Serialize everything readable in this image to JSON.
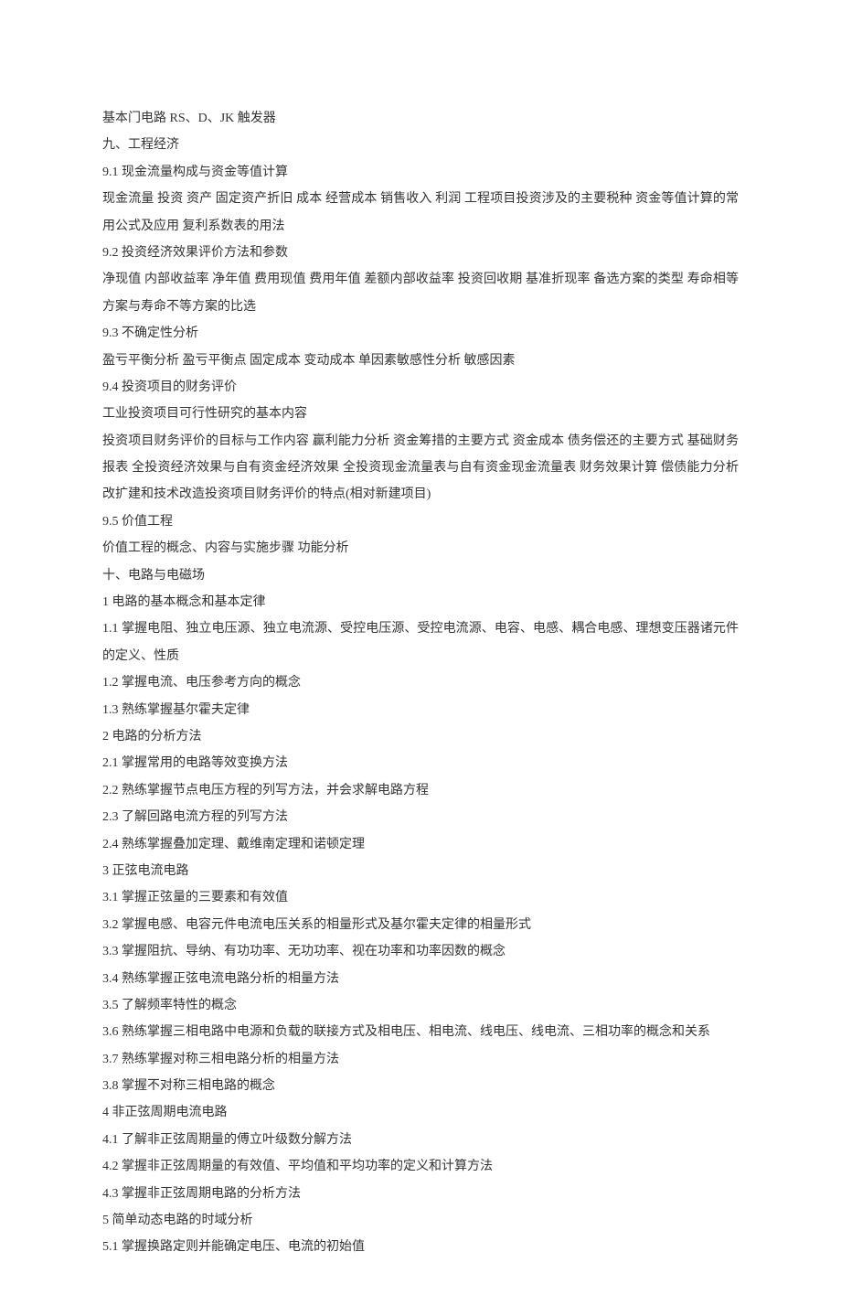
{
  "lines": [
    "基本门电路 RS、D、JK 触发器",
    "九、工程经济",
    "9.1 现金流量构成与资金等值计算",
    "现金流量 投资 资产 固定资产折旧 成本 经营成本 销售收入 利润 工程项目投资涉及的主要税种 资金等值计算的常用公式及应用 复利系数表的用法",
    "9.2 投资经济效果评价方法和参数",
    "净现值 内部收益率 净年值 费用现值 费用年值 差额内部收益率 投资回收期 基准折现率 备选方案的类型 寿命相等方案与寿命不等方案的比选",
    "9.3 不确定性分析",
    "盈亏平衡分析 盈亏平衡点 固定成本 变动成本 单因素敏感性分析 敏感因素",
    "9.4 投资项目的财务评价",
    "工业投资项目可行性研究的基本内容",
    "投资项目财务评价的目标与工作内容 赢利能力分析 资金筹措的主要方式 资金成本 债务偿还的主要方式 基础财务报表 全投资经济效果与自有资金经济效果 全投资现金流量表与自有资金现金流量表 财务效果计算 偿债能力分析 改扩建和技术改造投资项目财务评价的特点(相对新建项目)",
    "9.5 价值工程",
    "价值工程的概念、内容与实施步骤 功能分析",
    "十、电路与电磁场",
    "1 电路的基本概念和基本定律",
    "1.1 掌握电阻、独立电压源、独立电流源、受控电压源、受控电流源、电容、电感、耦合电感、理想变压器诸元件的定义、性质",
    "1.2 掌握电流、电压参考方向的概念",
    "1.3 熟练掌握基尔霍夫定律",
    "2 电路的分析方法",
    "2.1 掌握常用的电路等效变换方法",
    "2.2 熟练掌握节点电压方程的列写方法，并会求解电路方程",
    "2.3 了解回路电流方程的列写方法",
    "2.4 熟练掌握叠加定理、戴维南定理和诺顿定理",
    "3 正弦电流电路",
    "3.1 掌握正弦量的三要素和有效值",
    "3.2 掌握电感、电容元件电流电压关系的相量形式及基尔霍夫定律的相量形式",
    "3.3 掌握阻抗、导纳、有功功率、无功功率、视在功率和功率因数的概念",
    "3.4 熟练掌握正弦电流电路分析的相量方法",
    "3.5 了解频率特性的概念",
    "3.6 熟练掌握三相电路中电源和负载的联接方式及相电压、相电流、线电压、线电流、三相功率的概念和关系",
    "3.7 熟练掌握对称三相电路分析的相量方法",
    "3.8 掌握不对称三相电路的概念",
    "4 非正弦周期电流电路",
    "4.1 了解非正弦周期量的傅立叶级数分解方法",
    "4.2 掌握非正弦周期量的有效值、平均值和平均功率的定义和计算方法",
    "4.3 掌握非正弦周期电路的分析方法",
    "5 简单动态电路的时域分析",
    "5.1 掌握换路定则并能确定电压、电流的初始值"
  ]
}
